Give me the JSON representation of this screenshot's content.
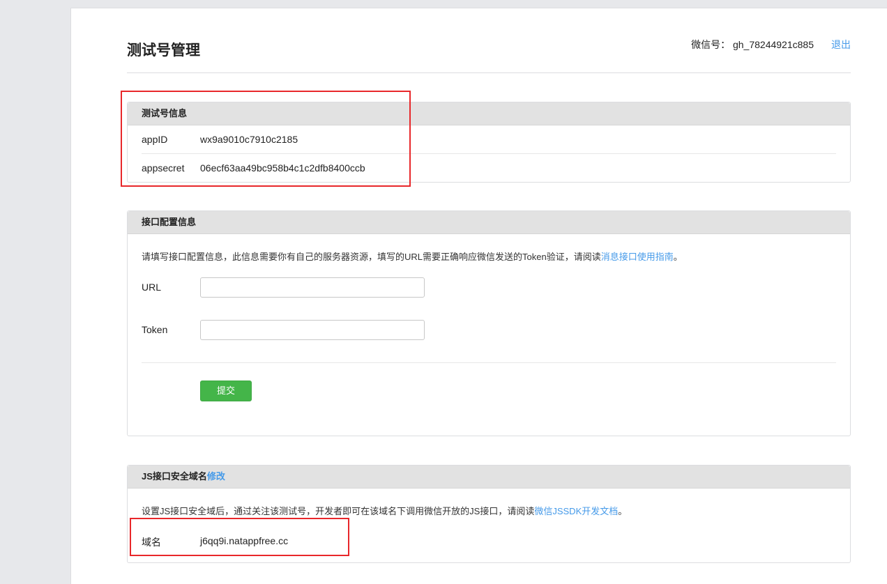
{
  "header": {
    "title": "测试号管理",
    "account_label": "微信号：",
    "account_id": "gh_78244921c885",
    "logout_label": "退出"
  },
  "test_account_info": {
    "title": "测试号信息",
    "rows": [
      {
        "label": "appID",
        "value": "wx9a9010c7910c2185"
      },
      {
        "label": "appsecret",
        "value": "06ecf63aa49bc958b4c1c2dfb8400ccb"
      }
    ]
  },
  "interface_config": {
    "title": "接口配置信息",
    "description": "请填写接口配置信息，此信息需要你有自己的服务器资源，填写的URL需要正确响应微信发送的Token验证，请阅读",
    "doc_link": "消息接口使用指南",
    "description_end": "。",
    "url_label": "URL",
    "url_value": "",
    "token_label": "Token",
    "token_value": "",
    "submit_label": "提交"
  },
  "js_domain": {
    "title": "JS接口安全域名",
    "edit_link": "修改",
    "description": "设置JS接口安全域后，通过关注该测试号，开发者即可在该域名下调用微信开放的JS接口，请阅读",
    "doc_link": "微信JSSDK开发文档",
    "description_end": "。",
    "domain_label": "域名",
    "domain_value": "j6qq9i.natappfree.cc"
  },
  "colors": {
    "accent_link": "#459ae9",
    "button_green": "#44b549",
    "highlight_red": "#e8272a"
  }
}
